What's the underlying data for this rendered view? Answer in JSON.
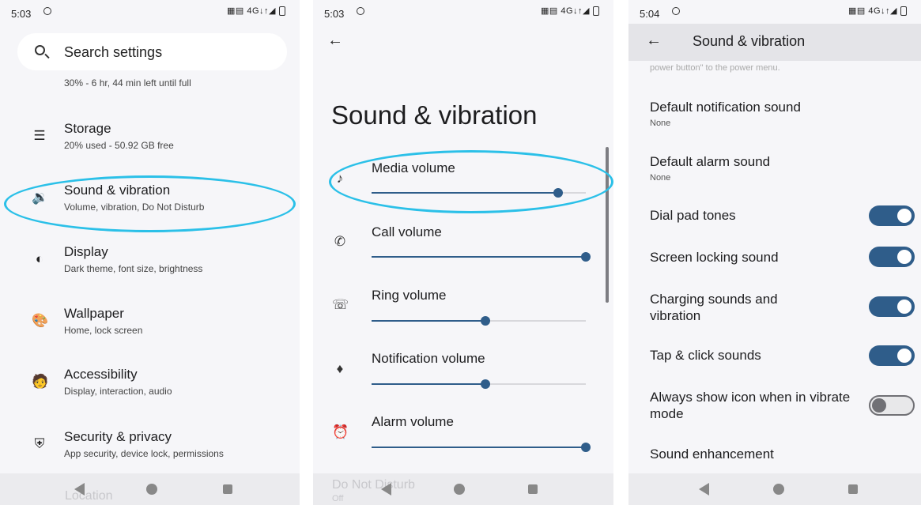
{
  "panel1": {
    "status_time": "5:03",
    "status_icons": "▦▤ 4G↓↑◢",
    "search_label": "Search settings",
    "battery_sub": "30% - 6 hr, 44 min left until full",
    "items": [
      {
        "title": "Storage",
        "sub": "20% used - 50.92 GB free",
        "icon": "storage-icon"
      },
      {
        "title": "Sound & vibration",
        "sub": "Volume, vibration, Do Not Disturb",
        "icon": "speaker-icon"
      },
      {
        "title": "Display",
        "sub": "Dark theme, font size, brightness",
        "icon": "display-icon"
      },
      {
        "title": "Wallpaper",
        "sub": "Home, lock screen",
        "icon": "palette-icon"
      },
      {
        "title": "Accessibility",
        "sub": "Display, interaction, audio",
        "icon": "accessibility-icon"
      },
      {
        "title": "Security & privacy",
        "sub": "App security, device lock, permissions",
        "icon": "shield-icon"
      }
    ],
    "behind_nav": "Location"
  },
  "panel2": {
    "status_time": "5:03",
    "status_icons": "▦▤ 4G↓↑◢",
    "title": "Sound & vibration",
    "volumes": [
      {
        "label": "Media volume",
        "level": 0.87,
        "icon": "music-note-icon"
      },
      {
        "label": "Call volume",
        "level": 1.0,
        "icon": "phone-icon"
      },
      {
        "label": "Ring volume",
        "level": 0.53,
        "icon": "ring-icon"
      },
      {
        "label": "Notification volume",
        "level": 0.53,
        "icon": "bell-icon"
      },
      {
        "label": "Alarm volume",
        "level": 1.0,
        "icon": "alarm-clock-icon"
      }
    ],
    "behind_nav": "Do Not Disturb",
    "behind_nav_sub": "Off"
  },
  "panel3": {
    "status_time": "5:04",
    "status_icons": "▦▤ 4G↓↑◢",
    "appbar_title": "Sound & vibration",
    "cut_text": "power button\" to the power menu.",
    "settings": [
      {
        "title": "Default notification sound",
        "sub": "None"
      },
      {
        "title": "Default alarm sound",
        "sub": "None"
      }
    ],
    "toggles": [
      {
        "title": "Dial pad tones",
        "on": true
      },
      {
        "title": "Screen locking sound",
        "on": true
      },
      {
        "title": "Charging sounds and vibration",
        "on": true
      },
      {
        "title": "Tap & click sounds",
        "on": true
      },
      {
        "title": "Always show icon when in vibrate mode",
        "on": false
      }
    ],
    "last_item": "Sound enhancement"
  },
  "colors": {
    "accent": "#2f5d8a",
    "highlight": "#2bc0e8"
  }
}
